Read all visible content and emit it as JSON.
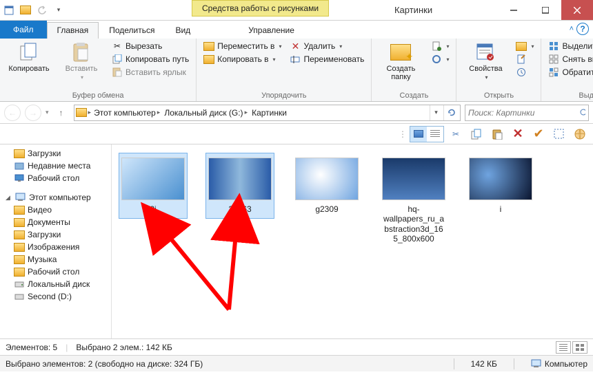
{
  "window": {
    "title": "Картинки",
    "context_tab": "Средства работы с рисунками"
  },
  "tabs": {
    "file": "Файл",
    "home": "Главная",
    "share": "Поделиться",
    "view": "Вид",
    "manage": "Управление"
  },
  "ribbon": {
    "clipboard": {
      "label": "Буфер обмена",
      "copy": "Копировать",
      "paste": "Вставить",
      "cut": "Вырезать",
      "copy_path": "Копировать путь",
      "paste_shortcut": "Вставить ярлык"
    },
    "organize": {
      "label": "Упорядочить",
      "move_to": "Переместить в",
      "copy_to": "Копировать в",
      "delete": "Удалить",
      "rename": "Переименовать"
    },
    "new": {
      "label": "Создать",
      "new_folder": "Создать\nпапку"
    },
    "open": {
      "label": "Открыть",
      "properties": "Свойства"
    },
    "select": {
      "label": "Выделить",
      "select_all": "Выделить все",
      "select_none": "Снять выделение",
      "invert": "Обратить выделение"
    }
  },
  "breadcrumb": {
    "root": "Этот компьютер",
    "drive": "Локальный диск (G:)",
    "folder": "Картинки"
  },
  "search": {
    "placeholder": "Поиск: Картинки"
  },
  "sidebar": {
    "downloads": "Загрузки",
    "recent": "Недавние места",
    "desktop": "Рабочий стол",
    "this_pc": "Этот компьютер",
    "videos": "Видео",
    "documents": "Документы",
    "downloads2": "Загрузки",
    "pictures": "Изображения",
    "music": "Музыка",
    "desktop2": "Рабочий стол",
    "local_disk": "Локальный диск",
    "second": "Second (D:)"
  },
  "files": {
    "f1": "2i",
    "f2": "20763",
    "f3": "g2309",
    "f4": "hq-wallpapers_ru_abstraction3d_165_800x600",
    "f5": "i"
  },
  "status": {
    "count_label": "Элементов:",
    "count": "5",
    "sel_label": "Выбрано 2 элем.:",
    "sel_size": "142 КБ",
    "line2": "Выбрано элементов: 2 (свободно на диске: 324 ГБ)",
    "size2": "142 КБ",
    "computer": "Компьютер"
  }
}
